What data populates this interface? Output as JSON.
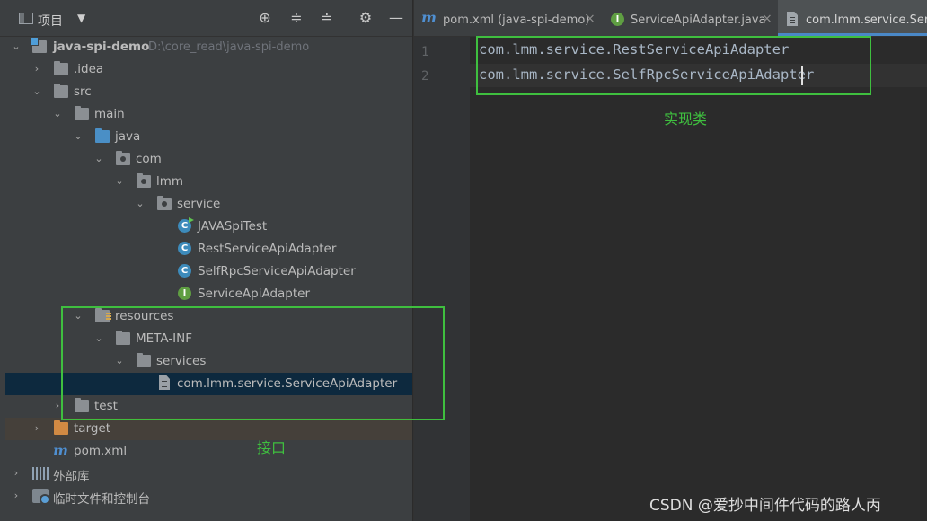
{
  "panel": {
    "title": "项目",
    "dropdown": "▼",
    "toolbar": {
      "locate": "⊕",
      "expand": "≑",
      "collapse": "≐",
      "settings": "⚙",
      "hide": "—"
    }
  },
  "tree": {
    "root": {
      "label": "java-spi-demo",
      "path": "D:\\core_read\\java-spi-demo"
    },
    "idea": ".idea",
    "src": "src",
    "main": "main",
    "java": "java",
    "com": "com",
    "lmm": "lmm",
    "service": "service",
    "classes": [
      {
        "label": "JAVASpiTest",
        "kind": "class-runnable",
        "glyph": "C"
      },
      {
        "label": "RestServiceApiAdapter",
        "kind": "class",
        "glyph": "C"
      },
      {
        "label": "SelfRpcServiceApiAdapter",
        "kind": "class",
        "glyph": "C"
      },
      {
        "label": "ServiceApiAdapter",
        "kind": "interface",
        "glyph": "I"
      }
    ],
    "resources": "resources",
    "meta_inf": "META-INF",
    "services": "services",
    "spi_file": "com.lmm.service.ServiceApiAdapter",
    "test": "test",
    "target": "target",
    "pom": "pom.xml",
    "external_libs": "外部库",
    "scratches": "临时文件和控制台"
  },
  "tabs": [
    {
      "label": "pom.xml (java-spi-demo)",
      "icon": "m",
      "close": "×"
    },
    {
      "label": "ServiceApiAdapter.java",
      "icon": "I",
      "close": "×"
    },
    {
      "label": "com.lmm.service.ServiceApiAdapter",
      "icon": "file",
      "close": ""
    }
  ],
  "editor": {
    "line_numbers": [
      "1",
      "2"
    ],
    "lines": [
      "com.lmm.service.RestServiceApiAdapter",
      "com.lmm.service.SelfRpcServiceApiAdapter"
    ]
  },
  "annotations": {
    "impl_label": "实现类",
    "interface_label": "接口",
    "color": "#3fbf3f"
  },
  "watermark": "CSDN @爱抄中间件代码的路人丙",
  "colors": {
    "panel_bg": "#3c3f41",
    "editor_bg": "#2b2b2b",
    "selection": "#0d293e",
    "excluded": "#45403a",
    "active_tab_underline": "#4a88c7"
  }
}
